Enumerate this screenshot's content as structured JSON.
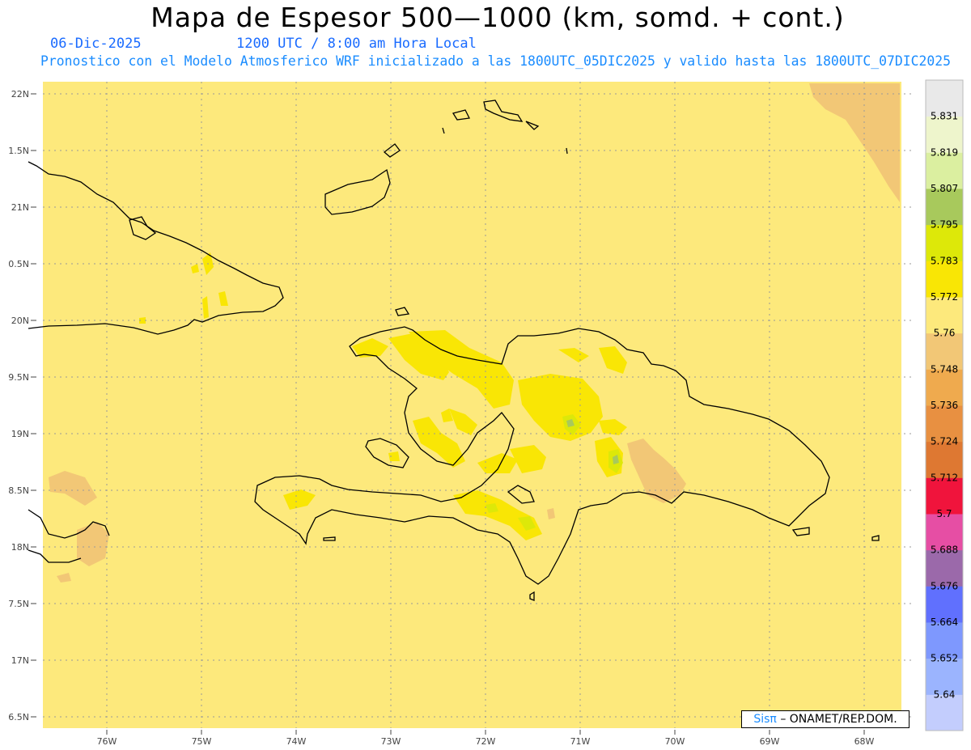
{
  "header": {
    "title": "Mapa de Espesor 500—1000 (km, somd. + cont.)",
    "date": "06-Dic-2025",
    "time": "1200 UTC / 8:00 am Hora Local",
    "description": "Pronostico con el Modelo Atmosferico WRF inicializado a las 1800UTC_05DIC2025 y valido hasta las  1800UTC_07DIC2025"
  },
  "map": {
    "lat_labels": [
      "22N",
      "1.5N",
      "21N",
      "0.5N",
      "20N",
      "9.5N",
      "19N",
      "8.5N",
      "18N",
      "7.5N",
      "17N",
      "6.5N"
    ],
    "lon_labels": [
      "76W",
      "75W",
      "74W",
      "73W",
      "72W",
      "71W",
      "70W",
      "69W",
      "68W"
    ],
    "background_color": "#fde97c"
  },
  "colorbar": {
    "labels": [
      "5.831",
      "5.819",
      "5.807",
      "5.795",
      "5.783",
      "5.772",
      "5.76",
      "5.748",
      "5.736",
      "5.724",
      "5.712",
      "5.7",
      "5.688",
      "5.676",
      "5.664",
      "5.652",
      "5.64"
    ],
    "colors": [
      "#c3cdfd",
      "#9bb4fe",
      "#7e98fe",
      "#6070fe",
      "#9b69aa",
      "#e64ea4",
      "#f0143c",
      "#de7832",
      "#e89041",
      "#efaa4e",
      "#f2c776",
      "#fde97c",
      "#f9e605",
      "#dde809",
      "#a8c95c",
      "#dbefa0",
      "#eef5cc",
      "#e9e9e9"
    ]
  },
  "credit": {
    "brand": "Sisπ",
    "text": "– ONAMET/REP.DOM."
  }
}
